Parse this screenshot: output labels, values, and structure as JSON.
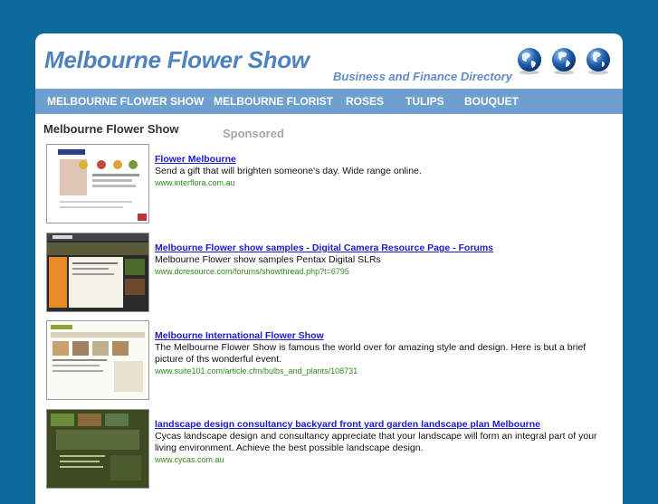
{
  "header": {
    "site_title": "Melbourne Flower Show",
    "tagline": "Business and Finance Directory",
    "globe_icons": [
      "globe-icon",
      "globe-icon",
      "globe-icon"
    ]
  },
  "nav": {
    "items": [
      {
        "label": "MELBOURNE FLOWER SHOW"
      },
      {
        "label": "MELBOURNE FLORIST"
      },
      {
        "label": "ROSES"
      },
      {
        "label": "TULIPS"
      },
      {
        "label": "BOUQUET"
      }
    ]
  },
  "main": {
    "section_title": "Melbourne Flower Show",
    "sponsored_label": "Sponsored",
    "results": [
      {
        "title": "Flower Melbourne",
        "description": "Send a gift that will brighten someone's day. Wide range online.",
        "url": "www.interflora.com.au"
      },
      {
        "title": "Melbourne Flower show samples - Digital Camera Resource Page - Forums",
        "description": "Melbourne Flower show samples Pentax Digital SLRs",
        "url": "www.dcresource.com/forums/showthread.php?t=6795"
      },
      {
        "title": "Melbourne International Flower Show",
        "description": "The Melbourne Flower Show is famous the world over for amazing style and design. Here is but a brief picture of ths wonderful event.",
        "url": "www.suite101.com/article.cfm/bulbs_and_plants/108731"
      },
      {
        "title": "landscape design consultancy backyard front yard garden landscape plan Melbourne",
        "description": "Cycas landscape design and consultancy appreciate that your landscape will form an integral part of your living environment. Achieve the best possible landscape design.",
        "url": "www.cycas.com.au"
      }
    ]
  },
  "colors": {
    "background": "#0e6a9a",
    "title_blue": "#4f83c0",
    "nav_bar": "#6d9fd0",
    "link": "#1a1ad0",
    "url_green": "#2f8a1e"
  }
}
